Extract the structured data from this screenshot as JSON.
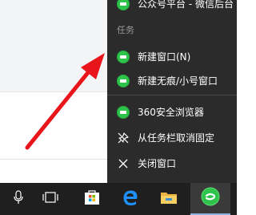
{
  "jump_list": {
    "top_item_label": "公众号平台 - 微信后台",
    "tasks_heading": "任务",
    "new_window_label": "新建窗口(N)",
    "new_private_window_label": "新建无痕/小号窗口",
    "app_name_label": "360安全浏览器",
    "unpin_label": "从任务栏取消固定",
    "close_window_label": "关闭窗口"
  },
  "taskbar": {
    "icons": [
      "microphone-icon",
      "task-view-icon",
      "store-icon",
      "edge-icon",
      "file-explorer-icon",
      "360-browser-icon"
    ],
    "active_app": "360-browser-icon"
  },
  "colors": {
    "jumplist_bg": "#2b2b2b",
    "taskbar_bg": "#1f1f1f",
    "browser_green": "#2ec44b",
    "edge_blue": "#1e90ff",
    "arrow_red": "#e8151b"
  }
}
